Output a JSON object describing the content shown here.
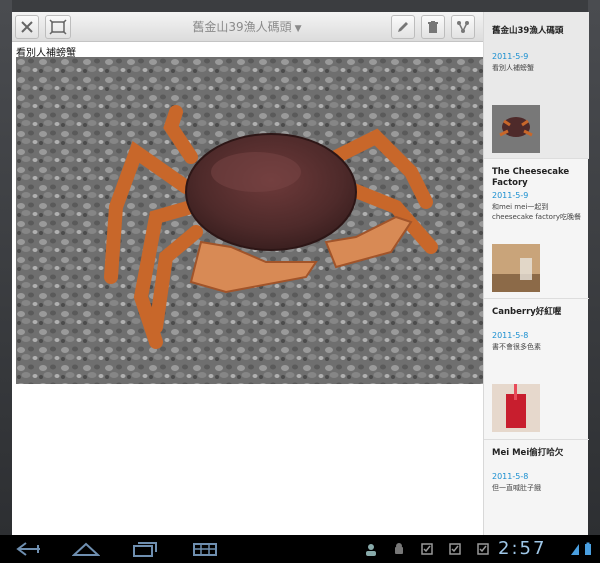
{
  "toolbar": {
    "title": "舊金山39漁人碼頭",
    "close_icon": "close-icon",
    "crop_icon": "crop-icon",
    "edit_icon": "pencil-icon",
    "delete_icon": "trash-icon",
    "share_icon": "share-icon"
  },
  "post": {
    "caption": "看別人補螃蟹",
    "image": "crab-photo"
  },
  "sidebar": {
    "items": [
      {
        "title": "舊金山39漁人碼頭",
        "date": "2011-5-9",
        "desc": "看別人補螃蟹",
        "thumb": "crab-thumb"
      },
      {
        "title": "The Cheesecake Factory",
        "date": "2011-5-9",
        "desc": "和mei mei一起到cheesecake factory吃晚餐",
        "thumb": "cheesecake-thumb"
      },
      {
        "title": "Canberry好紅喔",
        "date": "2011-5-8",
        "desc": "書不會很多色素",
        "thumb": "drink-thumb"
      },
      {
        "title": "Mei Mei偷打哈欠",
        "date": "2011-5-8",
        "desc": "但一直喊肚子餓"
      }
    ]
  },
  "system_bar": {
    "clock": "2:57",
    "icons": [
      "back-icon",
      "home-icon",
      "recent-apps-icon",
      "menu-icon",
      "avatar-icon",
      "android-icon",
      "notification-icon",
      "notification-icon",
      "notification-icon",
      "wifi-icon",
      "battery-icon"
    ]
  },
  "colors": {
    "accent": "#1a8fd0",
    "clock": "#9fc7e8",
    "toolbar": "#e6e6e6"
  }
}
